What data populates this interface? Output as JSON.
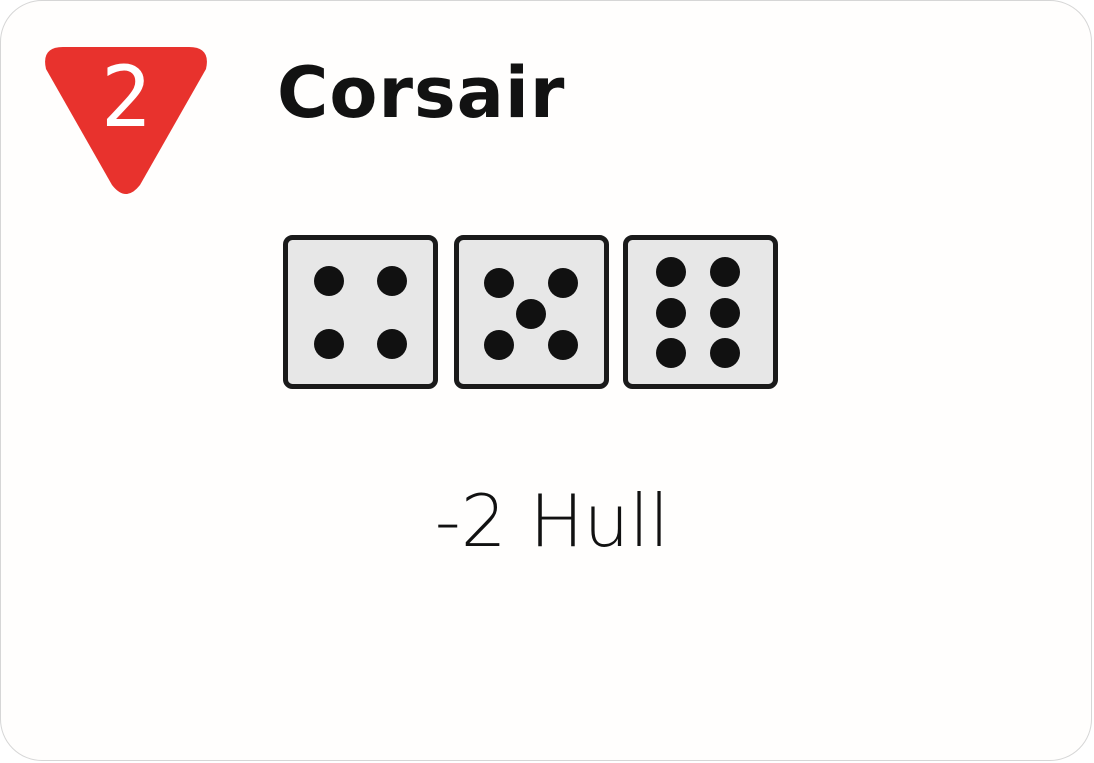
{
  "card": {
    "badge_value": "2",
    "badge_color": "#e8322d",
    "title": "Corsair",
    "dice": [
      {
        "face": 4,
        "icon": "die-four-icon"
      },
      {
        "face": 5,
        "icon": "die-five-icon"
      },
      {
        "face": 6,
        "icon": "die-six-icon"
      }
    ],
    "effect": "-2 Hull",
    "die_fill": "#e7e7e7",
    "pip_color": "#111111"
  }
}
